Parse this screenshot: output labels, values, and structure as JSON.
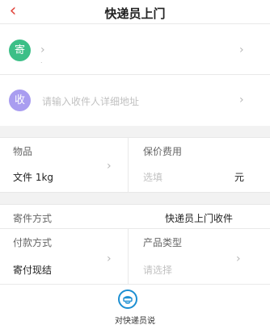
{
  "navbar": {
    "back_icon": "‹",
    "title": "快递员上门"
  },
  "sender": {
    "badge": "寄",
    "badge_color": "#3cbf87",
    "value": "",
    "dot": "."
  },
  "receiver": {
    "badge": "收",
    "badge_color": "#a99df0",
    "placeholder": "请输入收件人详细地址"
  },
  "item": {
    "label": "物品",
    "value": "文件 1kg"
  },
  "insured": {
    "label": "保价费用",
    "placeholder": "选填",
    "unit": "元"
  },
  "send_method": {
    "label": "寄件方式",
    "value": "快递员上门收件"
  },
  "payment": {
    "label": "付款方式",
    "value": "寄付现结"
  },
  "product_type": {
    "label": "产品类型",
    "placeholder": "请选择"
  },
  "bottom": {
    "label": "对快递员说",
    "icon_color": "#1c8fd2"
  },
  "icons": {
    "chevron": "›"
  }
}
